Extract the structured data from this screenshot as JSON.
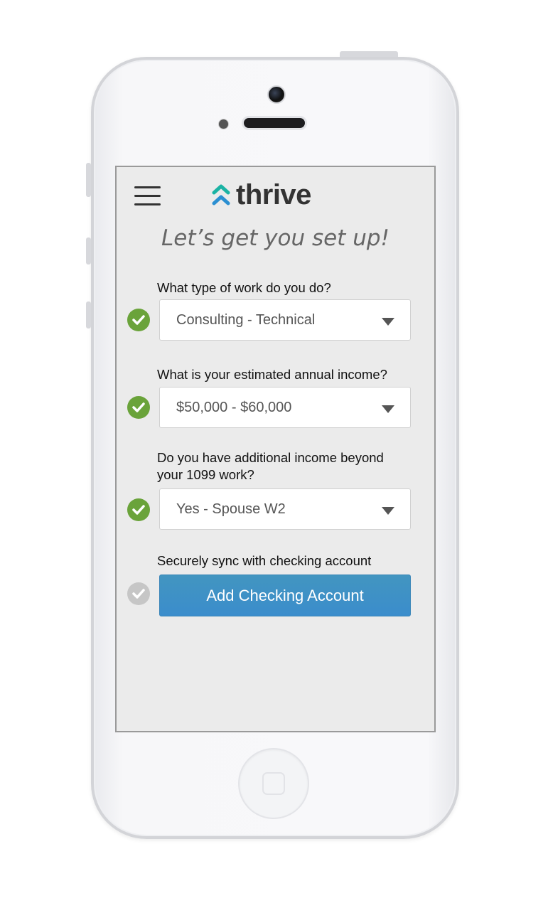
{
  "app": {
    "name": "thrive",
    "brand_colors": {
      "teal": "#1bb3a4",
      "blue": "#2b8fd1",
      "text": "#333333"
    }
  },
  "header": {
    "menu_icon": "hamburger-menu-icon",
    "title": "Let’s get you set up!"
  },
  "questions": [
    {
      "label": "What type of work do you do?",
      "value": "Consulting - Technical",
      "complete": true
    },
    {
      "label": "What is your estimated annual income?",
      "value": "$50,000 - $60,000",
      "complete": true
    },
    {
      "label": "Do you have additional income beyond",
      "label_line2": "your 1099 work?",
      "value": "Yes - Spouse W2",
      "complete": true
    }
  ],
  "sync": {
    "label": "Securely sync with checking account",
    "button_label": "Add Checking Account",
    "complete": false
  },
  "status_colors": {
    "complete": "#6aa33a",
    "pending": "#c6c6c6",
    "button": "#3b8dcc"
  }
}
